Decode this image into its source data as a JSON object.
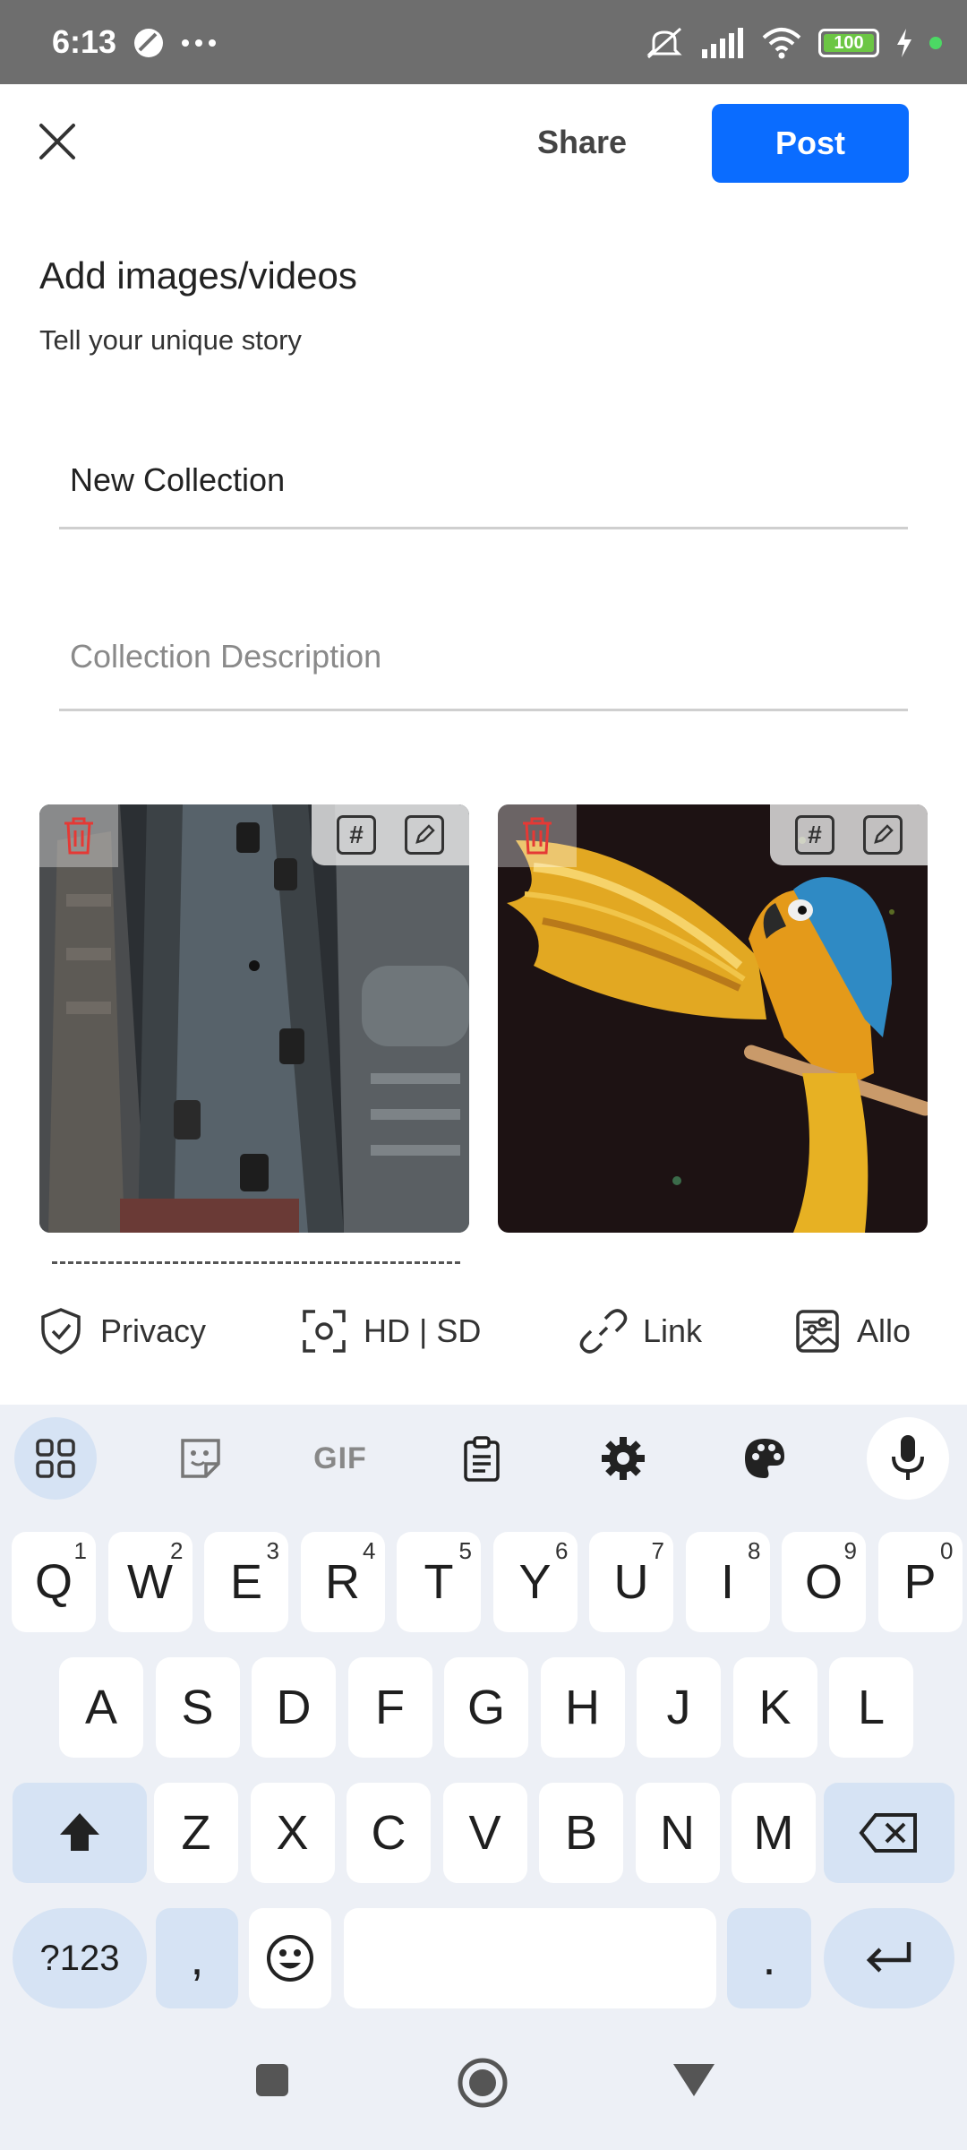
{
  "status_bar": {
    "time": "6:13",
    "battery": "100",
    "icons": [
      "app-icon",
      "more-dots-icon",
      "mute-icon",
      "signal-icon",
      "wifi-icon",
      "battery-icon",
      "charging-icon"
    ]
  },
  "header": {
    "close_icon": "close-icon",
    "share_label": "Share",
    "post_label": "Post"
  },
  "content": {
    "title": "Add images/videos",
    "subtitle": "Tell your unique story",
    "collection_name": "New Collection",
    "description_placeholder": "Collection Description"
  },
  "images": [
    {
      "description": "city street photo",
      "icons": [
        "trash-icon",
        "hashtag-icon",
        "edit-icon"
      ]
    },
    {
      "description": "parrot photo",
      "icons": [
        "trash-icon",
        "hashtag-icon",
        "edit-icon"
      ]
    }
  ],
  "options": {
    "privacy": "Privacy",
    "quality": "HD | SD",
    "link": "Link",
    "allow": "Allo"
  },
  "keyboard": {
    "row1": [
      {
        "k": "Q",
        "n": "1"
      },
      {
        "k": "W",
        "n": "2"
      },
      {
        "k": "E",
        "n": "3"
      },
      {
        "k": "R",
        "n": "4"
      },
      {
        "k": "T",
        "n": "5"
      },
      {
        "k": "Y",
        "n": "6"
      },
      {
        "k": "U",
        "n": "7"
      },
      {
        "k": "I",
        "n": "8"
      },
      {
        "k": "O",
        "n": "9"
      },
      {
        "k": "P",
        "n": "0"
      }
    ],
    "row2": [
      "A",
      "S",
      "D",
      "F",
      "G",
      "H",
      "J",
      "K",
      "L"
    ],
    "row3": [
      "Z",
      "X",
      "C",
      "V",
      "B",
      "N",
      "M"
    ],
    "symbols_label": "?123",
    "comma": ",",
    "period": ".",
    "gif_label": "GIF"
  },
  "colors": {
    "accent": "#0a6cff",
    "trash": "#e53935",
    "keyboard_bg": "#edf0f6",
    "special_key": "#d6e3f4"
  }
}
